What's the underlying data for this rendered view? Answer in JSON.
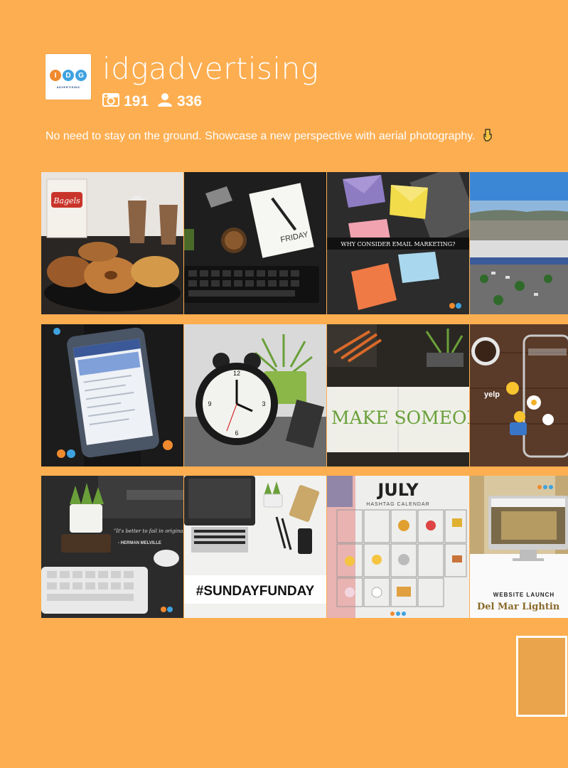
{
  "profile": {
    "username": "idgadvertising",
    "logo_letters": [
      "I",
      "D",
      "G"
    ],
    "logo_sub": "ADVERTISING",
    "logo_colors": [
      "#F08A2E",
      "#3FA2E0",
      "#3FA2E0"
    ],
    "posts_count": "191",
    "followers_count": "336",
    "posts_icon": "camera-icon",
    "followers_icon": "person-icon"
  },
  "bio": {
    "text": "No need to stay on the ground. Showcase a new perspective with aerial photography.",
    "emoji": "pointing-down-hand"
  },
  "posts": [
    {
      "id": "bagels-coffee",
      "label": "Bagels"
    },
    {
      "id": "desk-notebook",
      "label": "FRIDAY"
    },
    {
      "id": "email-marketing",
      "label": "WHY CONSIDER EMAIL MARKETING?"
    },
    {
      "id": "aerial-photo"
    },
    {
      "id": "phone-facebook"
    },
    {
      "id": "alarm-clock"
    },
    {
      "id": "make-someones-day",
      "label": "MAKE SOMEONE'S D"
    },
    {
      "id": "yelp-phone",
      "label": "yelp"
    },
    {
      "id": "quote-desk",
      "quote": "\"It's better to fail in originality than to succeed in imitation.\"",
      "author": "- HERMAN MELVILLE"
    },
    {
      "id": "sundayfunday",
      "label": "#SUNDAYFUNDAY"
    },
    {
      "id": "july-calendar",
      "title": "JULY",
      "subtitle": "HASHTAG CALENDAR"
    },
    {
      "id": "website-launch",
      "label": "WEBSITE LAUNCH",
      "brand": "Del Mar Lightin"
    }
  ],
  "colors": {
    "background": "#FDAE50",
    "scroll_box": "#E9A44C"
  }
}
